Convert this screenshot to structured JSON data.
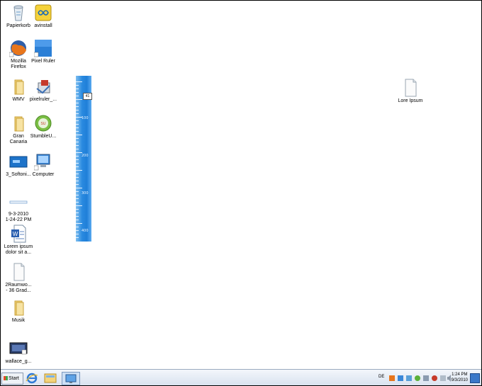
{
  "desktop_icons": [
    {
      "label": "Papierkorb",
      "icon": "recycle-bin-icon"
    },
    {
      "label": "avinstall",
      "icon": "avinstall-icon"
    },
    {
      "label": "Mozilla\nFirefox",
      "icon": "firefox-icon"
    },
    {
      "label": "Pixel Ruler",
      "icon": "pixel-ruler-icon"
    },
    {
      "label": "WMV",
      "icon": "folder-icon"
    },
    {
      "label": "pixelruler_...",
      "icon": "installer-icon"
    },
    {
      "label": "Gran\nCanaria",
      "icon": "folder-icon"
    },
    {
      "label": "StumbleU...",
      "icon": "stumbleupon-icon"
    },
    {
      "label": "3_Softoni...",
      "icon": "image-icon"
    },
    {
      "label": "Computer",
      "icon": "computer-icon"
    },
    {
      "label": "9-3-2010\n1-24-22 PM",
      "icon": "screenshot-icon"
    },
    {
      "label": "Lorem ipsum\ndolor sit a...",
      "icon": "word-document-icon"
    },
    {
      "label": "2Raumwo...\n- 36 Grad...",
      "icon": "document-icon"
    },
    {
      "label": "Musik",
      "icon": "folder-icon"
    },
    {
      "label": "wallace_g...",
      "icon": "image-icon"
    },
    {
      "label": "Lore Ipsum",
      "icon": "document-icon"
    }
  ],
  "ruler": {
    "labels": [
      "100",
      "200",
      "300",
      "400"
    ],
    "marker_value": "41"
  },
  "taskbar": {
    "start_label": "Start",
    "quick_launch": [
      "internet-explorer-icon",
      "folder-icon",
      "desktop-icon"
    ],
    "language": "DE",
    "clock_time": "1:24 PM",
    "clock_date": "9/3/2010"
  }
}
